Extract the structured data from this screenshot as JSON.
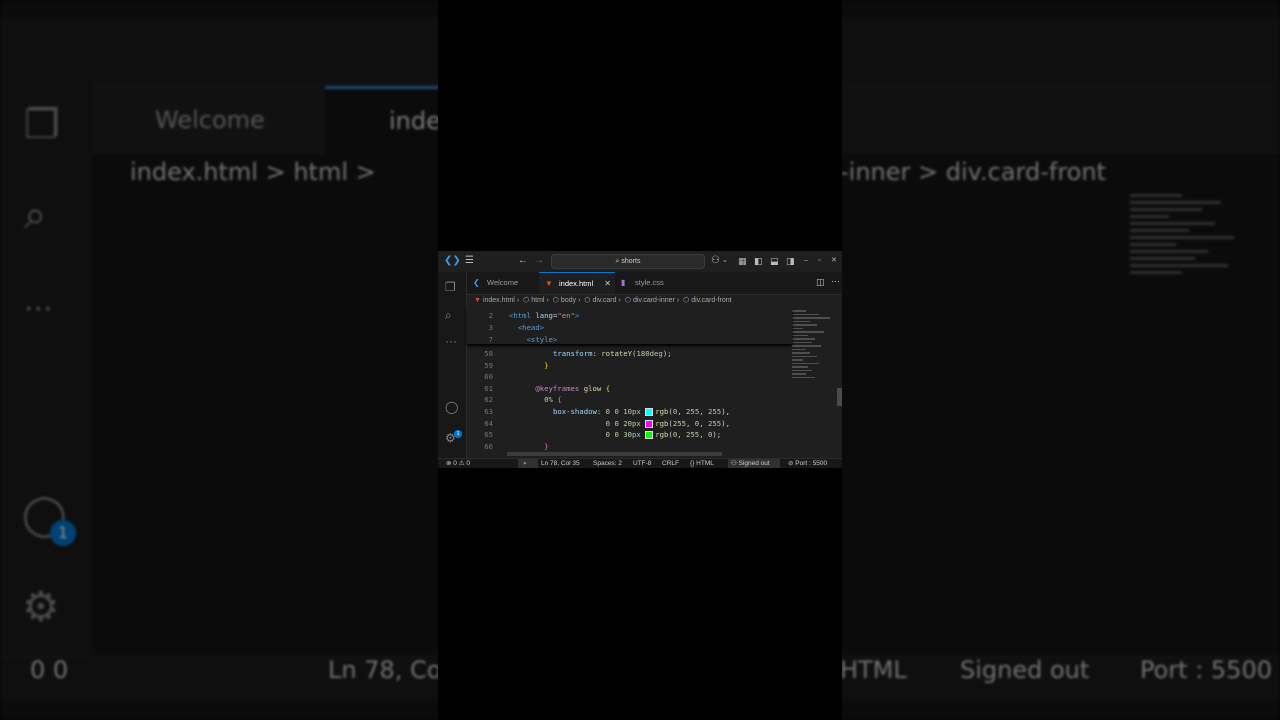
{
  "window": {
    "search_text": "shorts"
  },
  "tabs": [
    {
      "label": "Welcome",
      "icon": "vscode-logo-icon",
      "active": false
    },
    {
      "label": "index.html",
      "icon": "html5-icon",
      "active": true
    },
    {
      "label": "style.css",
      "icon": "css-icon",
      "active": false
    }
  ],
  "breadcrumb": [
    "index.html",
    "html",
    "body",
    "div.card",
    "div.card-inner",
    "div.card-front"
  ],
  "sticky_lines": [
    {
      "n": "2",
      "tokens": [
        [
          "tg",
          "<html "
        ],
        [
          "at",
          "lang"
        ],
        [
          "",
          "="
        ],
        [
          "st",
          "\"en\""
        ],
        [
          "tg",
          ">"
        ]
      ]
    },
    {
      "n": "3",
      "tokens": [
        [
          "tg",
          "  <head>"
        ]
      ]
    },
    {
      "n": "7",
      "tokens": [
        [
          "tg",
          "    <style>"
        ]
      ]
    }
  ],
  "code_lines": [
    {
      "n": "58",
      "tokens": [
        [
          "",
          "          "
        ],
        [
          "pr",
          "transform"
        ],
        [
          "",
          ": "
        ],
        [
          "fn",
          "rotateY"
        ],
        [
          "",
          "("
        ],
        [
          "nm",
          "180deg"
        ],
        [
          "",
          ");"
        ]
      ]
    },
    {
      "n": "59",
      "tokens": [
        [
          "",
          "        "
        ],
        [
          "br",
          "}"
        ]
      ]
    },
    {
      "n": "60",
      "tokens": [
        [
          "",
          ""
        ]
      ]
    },
    {
      "n": "61",
      "tokens": [
        [
          "",
          "      "
        ],
        [
          "kw",
          "@keyframes"
        ],
        [
          "",
          " "
        ],
        [
          "fn",
          "glow"
        ],
        [
          "",
          " "
        ],
        [
          "br",
          "{"
        ]
      ]
    },
    {
      "n": "62",
      "tokens": [
        [
          "",
          "        "
        ],
        [
          "nm",
          "0%"
        ],
        [
          "",
          " "
        ],
        [
          "br2",
          "{"
        ]
      ]
    },
    {
      "n": "63",
      "tokens": [
        [
          "",
          "          "
        ],
        [
          "pr",
          "box-shadow"
        ],
        [
          "",
          ": "
        ],
        [
          "nm",
          "0 0 10px"
        ],
        [
          "",
          " "
        ],
        [
          "sw",
          "#00ffff"
        ],
        [
          "fn",
          "rgb"
        ],
        [
          "",
          "("
        ],
        [
          "nm",
          "0"
        ],
        [
          "",
          ", "
        ],
        [
          "nm",
          "255"
        ],
        [
          "",
          ", "
        ],
        [
          "nm",
          "255"
        ],
        [
          "",
          "),"
        ]
      ]
    },
    {
      "n": "64",
      "tokens": [
        [
          "",
          "                      "
        ],
        [
          "nm",
          "0 0 20px"
        ],
        [
          "",
          " "
        ],
        [
          "sw",
          "#ff00ff"
        ],
        [
          "fn",
          "rgb"
        ],
        [
          "",
          "("
        ],
        [
          "nm",
          "255"
        ],
        [
          "",
          ", "
        ],
        [
          "nm",
          "0"
        ],
        [
          "",
          ", "
        ],
        [
          "nm",
          "255"
        ],
        [
          "",
          "),"
        ]
      ]
    },
    {
      "n": "65",
      "tokens": [
        [
          "",
          "                      "
        ],
        [
          "nm",
          "0 0 30px"
        ],
        [
          "",
          " "
        ],
        [
          "sw",
          "#00ff00"
        ],
        [
          "fn",
          "rgb"
        ],
        [
          "",
          "("
        ],
        [
          "nm",
          "0"
        ],
        [
          "",
          ", "
        ],
        [
          "nm",
          "255"
        ],
        [
          "",
          ", "
        ],
        [
          "nm",
          "0"
        ],
        [
          "",
          ");"
        ]
      ]
    },
    {
      "n": "66",
      "tokens": [
        [
          "",
          "        "
        ],
        [
          "br2",
          "}"
        ]
      ]
    }
  ],
  "status": {
    "errors": "0",
    "warnings": "0",
    "position": "Ln 78, Col 35",
    "spaces": "Spaces: 2",
    "encoding": "UTF-8",
    "eol": "CRLF",
    "language": "HTML",
    "account": "Signed out",
    "port": "Port : 5500"
  },
  "accounts_badge": "1",
  "background": {
    "tab_welcome": "Welcome",
    "tab_index": "inde",
    "crumb_left": "index.html > html >",
    "crumb_right": "-inner > div.card-front",
    "status_left": "0  0",
    "status_pos": "Ln 78, Col",
    "status_lang": "HTML",
    "status_signed": "Signed out",
    "status_port": "Port : 5500",
    "badge": "1"
  },
  "colors": {
    "accent": "#0078d4",
    "editor_bg": "#1f1f1f"
  }
}
